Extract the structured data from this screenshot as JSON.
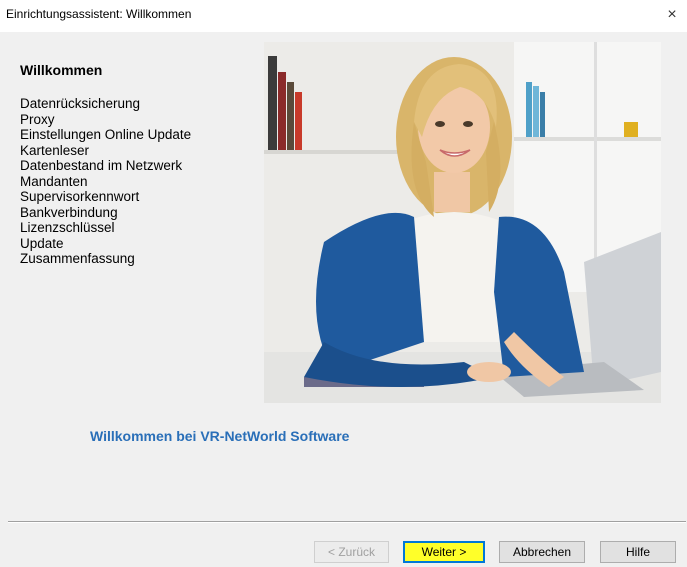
{
  "window": {
    "title": "Einrichtungsassistent: Willkommen",
    "close_symbol": "×"
  },
  "steps": {
    "heading": "Willkommen",
    "items": [
      "Datenrücksicherung",
      "Proxy",
      "Einstellungen Online Update",
      "Kartenleser",
      "Datenbestand im Netzwerk",
      "Mandanten",
      "Supervisorkennwort",
      "Bankverbindung",
      "Lizenzschlüssel",
      "Update",
      "Zusammenfassung"
    ]
  },
  "main": {
    "welcome_text": "Willkommen bei VR-NetWorld Software"
  },
  "buttons": {
    "back": "< Zurück",
    "next": "Weiter >",
    "cancel": "Abbrechen",
    "help": "Hilfe"
  },
  "colors": {
    "welcome": "#2a6fb8",
    "next_highlight": "#ffff29",
    "focus_border": "#0078d7"
  }
}
